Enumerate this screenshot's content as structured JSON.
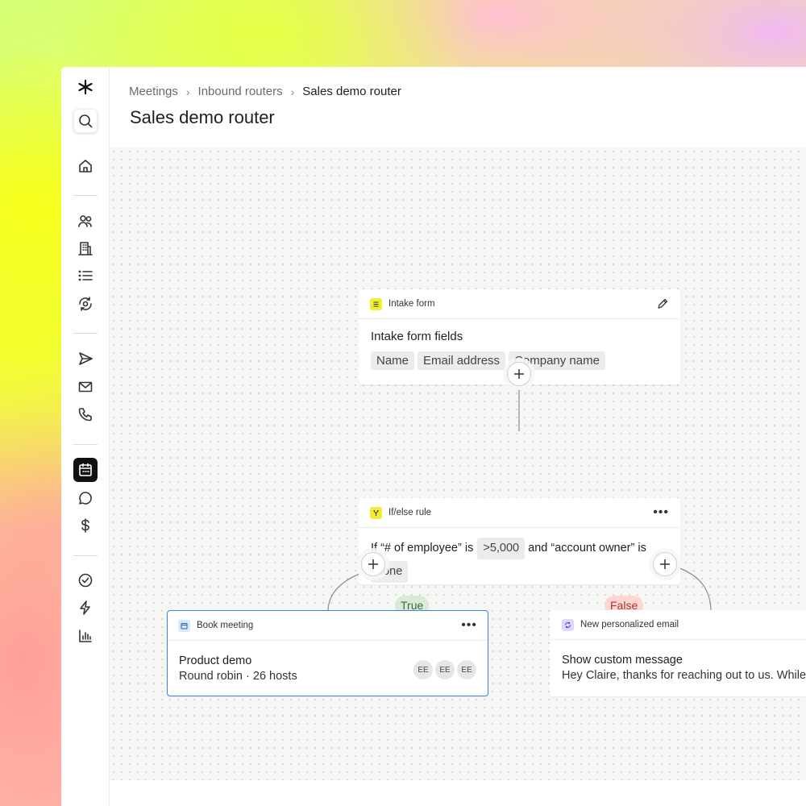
{
  "colors": {
    "accent_selected": "#3b82e6",
    "true_label_bg": "#d8ecd4",
    "true_label_fg": "#3f6b3a",
    "false_label_bg": "#ffd6d2",
    "false_label_fg": "#9c3a30",
    "intake_chip": "#f1ef32",
    "email_chip": "#e0d6ff"
  },
  "sidebar": {
    "logo": "asterisk-logo",
    "items": [
      {
        "name": "search",
        "icon": "search-icon"
      },
      {
        "name": "home",
        "icon": "home-icon"
      },
      {
        "name": "people",
        "icon": "people-icon"
      },
      {
        "name": "companies",
        "icon": "building-icon"
      },
      {
        "name": "lists",
        "icon": "list-icon"
      },
      {
        "name": "sync",
        "icon": "sync-icon"
      },
      {
        "name": "sequences",
        "icon": "send-icon"
      },
      {
        "name": "email",
        "icon": "mail-icon"
      },
      {
        "name": "calls",
        "icon": "phone-icon"
      },
      {
        "name": "meetings",
        "icon": "calendar-icon",
        "active": true
      },
      {
        "name": "conversations",
        "icon": "chat-icon"
      },
      {
        "name": "deals",
        "icon": "dollar-icon"
      },
      {
        "name": "tasks",
        "icon": "check-circle-icon"
      },
      {
        "name": "workflows",
        "icon": "lightning-icon"
      },
      {
        "name": "analytics",
        "icon": "bar-chart-icon"
      }
    ]
  },
  "header": {
    "breadcrumb": [
      "Meetings",
      "Inbound routers",
      "Sales demo router"
    ],
    "title": "Sales demo router"
  },
  "flow": {
    "intake": {
      "header": "Intake form",
      "title": "Intake form fields",
      "fields": [
        "Name",
        "Email address",
        "Company name"
      ]
    },
    "rule": {
      "header": "If/else rule",
      "text_1": "If “# of employee” is",
      "value_1": ">5,000",
      "text_2": "and “account owner” is",
      "value_2": "none"
    },
    "true_label": "True",
    "false_label": "False",
    "book": {
      "header": "Book meeting",
      "title": "Product demo",
      "subtitle": "Round robin · 26 hosts",
      "hosts": [
        "EE",
        "EE",
        "EE"
      ]
    },
    "email": {
      "header": "New personalized email",
      "title": "Show custom message",
      "body": "Hey Claire, thanks for reaching out to us. While"
    }
  }
}
